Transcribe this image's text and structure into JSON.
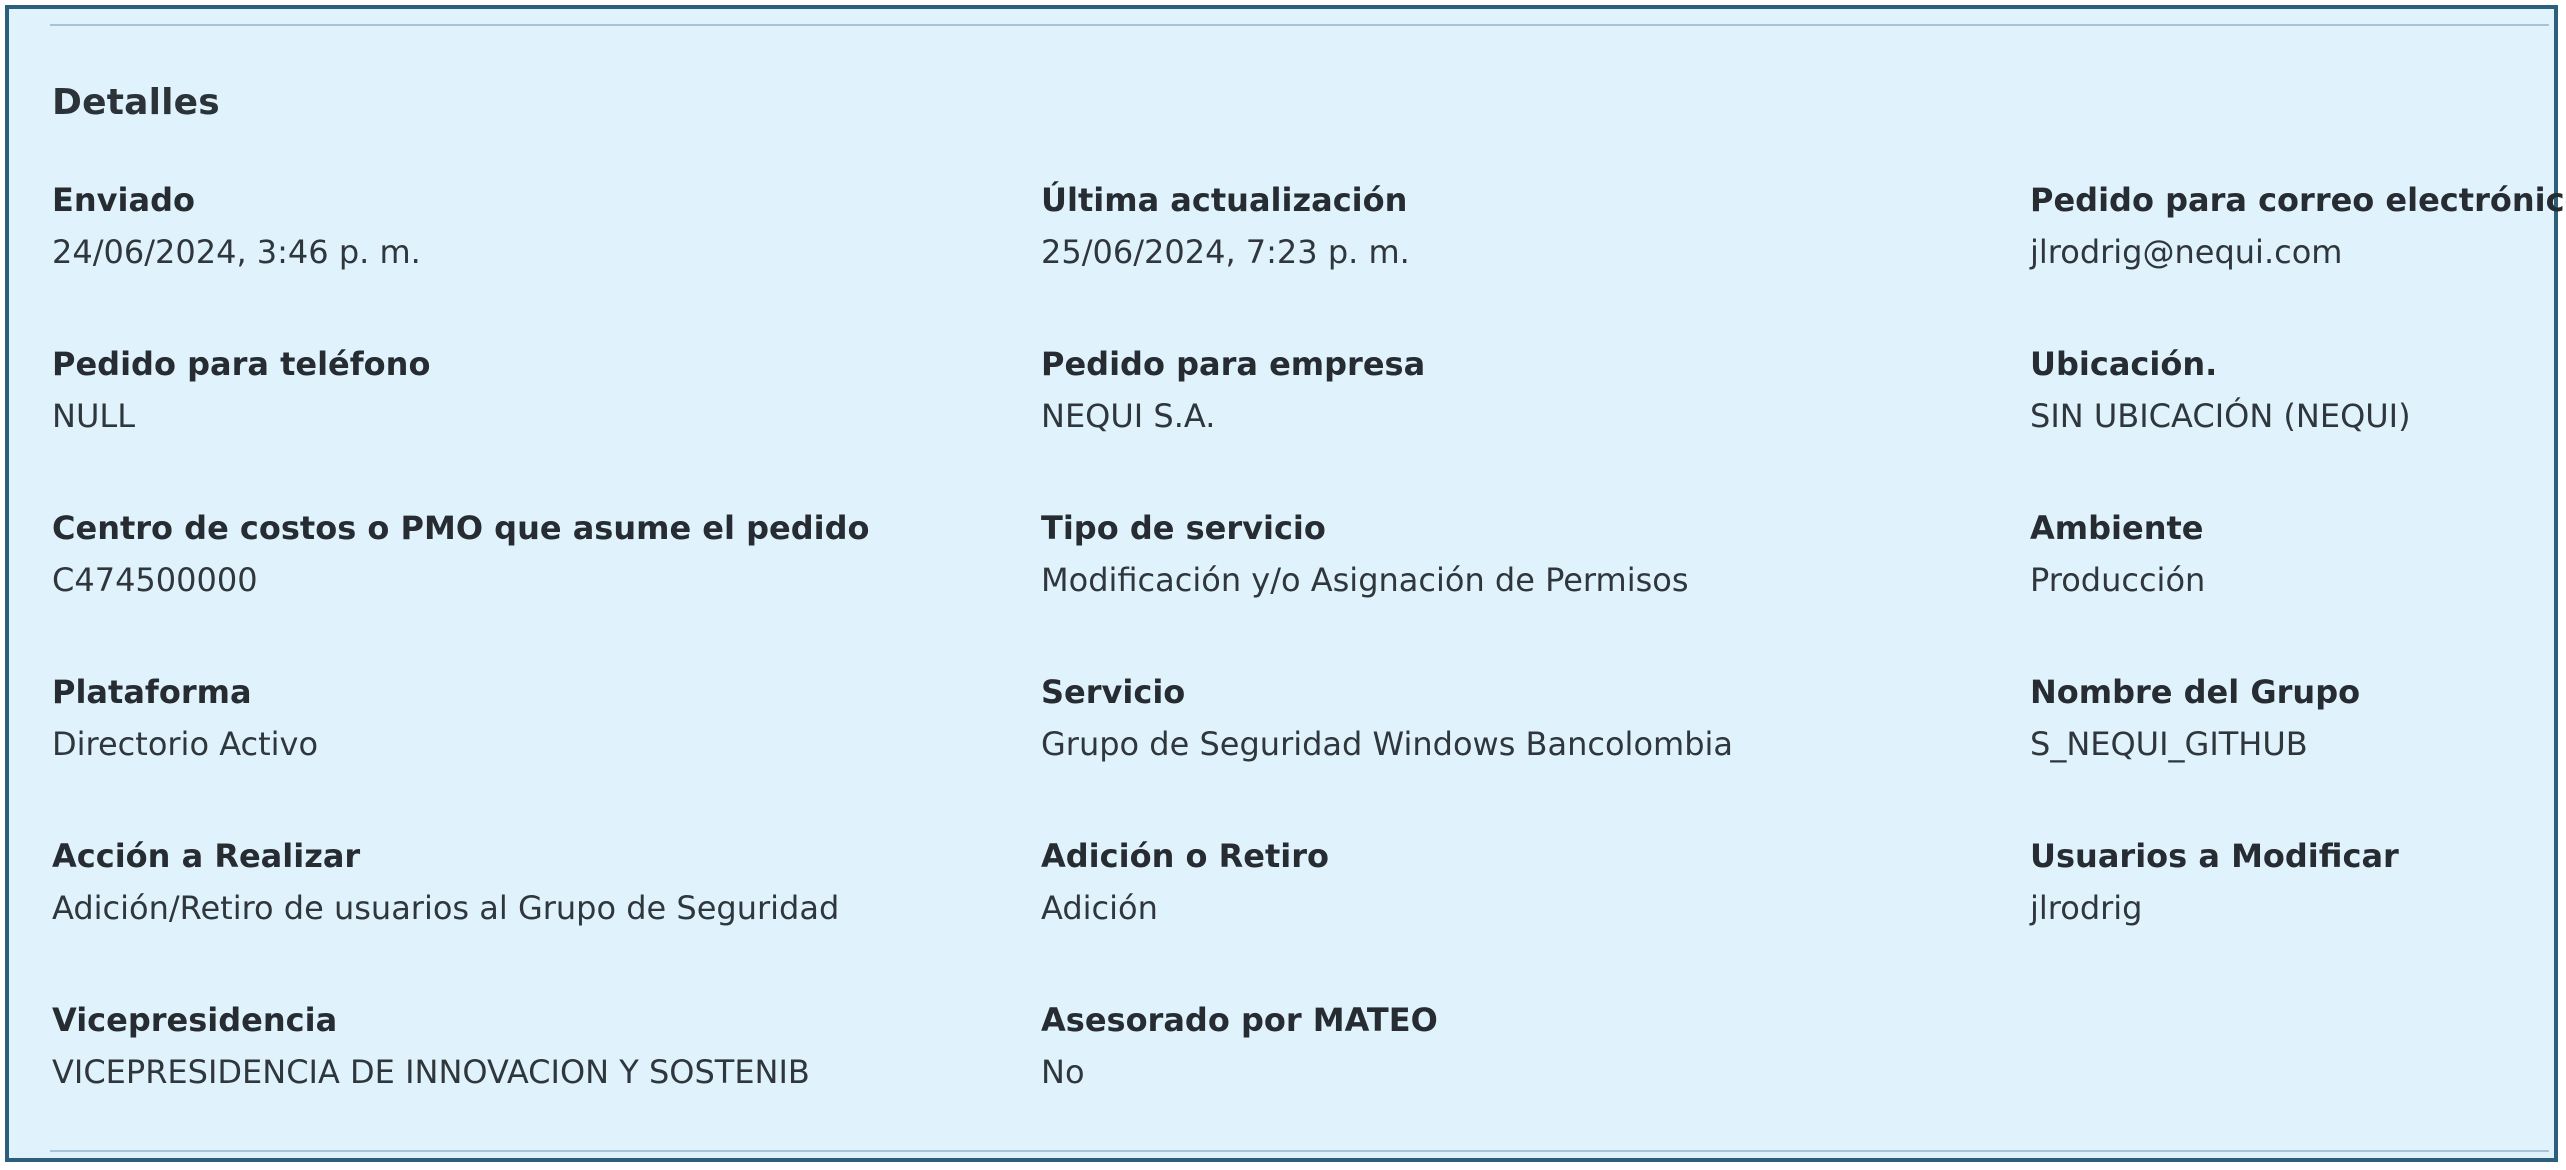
{
  "section": {
    "title": "Detalles"
  },
  "fields": [
    {
      "label": "Enviado",
      "value": "24/06/2024, 3:46 p. m."
    },
    {
      "label": "Última actualización",
      "value": "25/06/2024, 7:23 p. m."
    },
    {
      "label": "Pedido para correo electrónico",
      "value": "jlrodrig@nequi.com"
    },
    {
      "label": "Pedido para teléfono",
      "value": "NULL"
    },
    {
      "label": "Pedido para empresa",
      "value": "NEQUI S.A."
    },
    {
      "label": "Ubicación.",
      "value": "SIN UBICACIÓN (NEQUI)"
    },
    {
      "label": "Centro de costos o PMO que asume el pedido",
      "value": "C474500000"
    },
    {
      "label": "Tipo de servicio",
      "value": "Modificación y/o Asignación de Permisos"
    },
    {
      "label": "Ambiente",
      "value": "Producción"
    },
    {
      "label": "Plataforma",
      "value": "Directorio Activo"
    },
    {
      "label": "Servicio",
      "value": "Grupo de Seguridad Windows Bancolombia"
    },
    {
      "label": "Nombre del Grupo",
      "value": "S_NEQUI_GITHUB"
    },
    {
      "label": "Acción a Realizar",
      "value": "Adición/Retiro de usuarios al Grupo de Seguridad"
    },
    {
      "label": "Adición o Retiro",
      "value": "Adición"
    },
    {
      "label": "Usuarios a Modificar",
      "value": "jlrodrig"
    },
    {
      "label": "Vicepresidencia",
      "value": "VICEPRESIDENCIA DE INNOVACION Y SOSTENIB"
    },
    {
      "label": "Asesorado por MATEO",
      "value": "No"
    }
  ]
}
